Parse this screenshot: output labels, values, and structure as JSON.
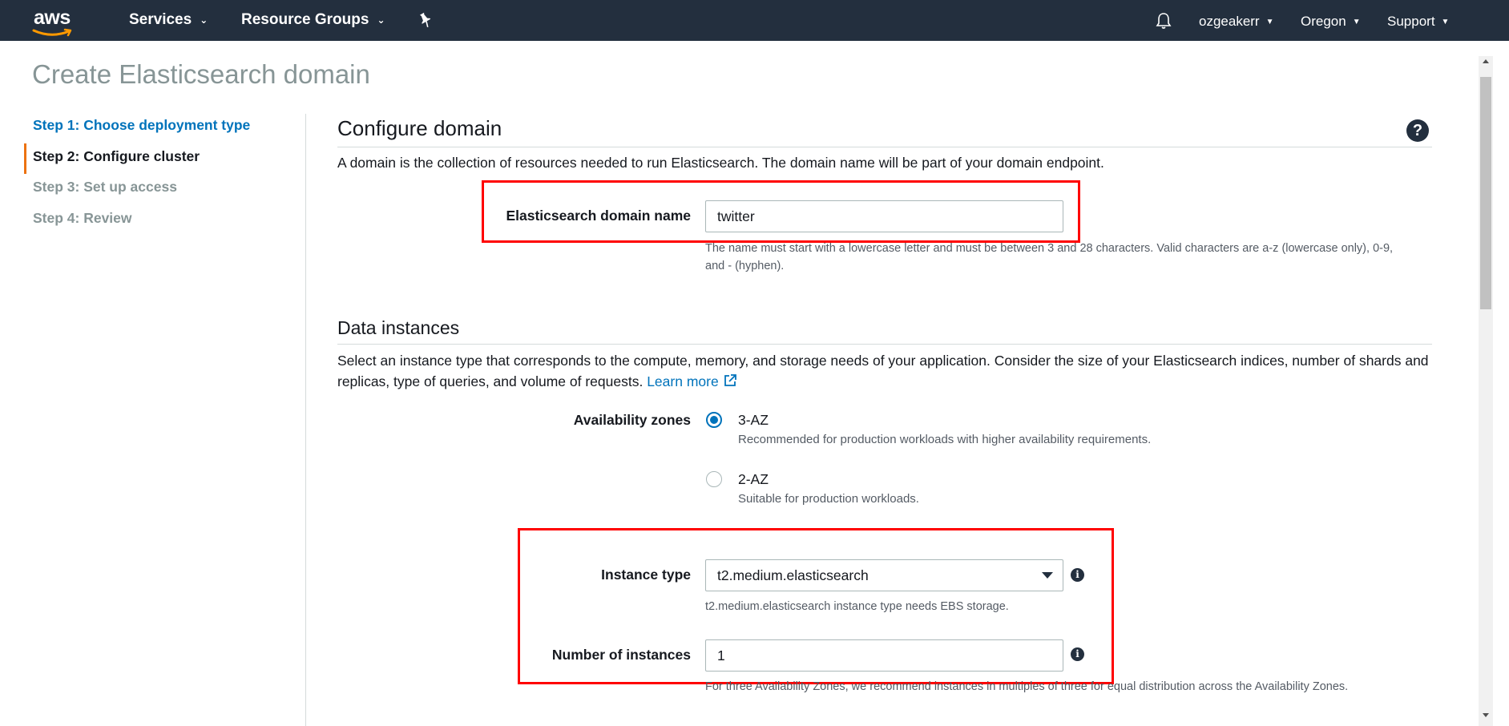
{
  "nav": {
    "logo_text": "aws",
    "services": "Services",
    "resource_groups": "Resource Groups",
    "user": "ozgeakerr",
    "region": "Oregon",
    "support": "Support"
  },
  "page_title": "Create Elasticsearch domain",
  "steps": [
    {
      "label": "Step 1: Choose deployment type",
      "state": "link"
    },
    {
      "label": "Step 2: Configure cluster",
      "state": "active"
    },
    {
      "label": "Step 3: Set up access",
      "state": "disabled"
    },
    {
      "label": "Step 4: Review",
      "state": "disabled"
    }
  ],
  "configure_domain": {
    "title": "Configure domain",
    "description": "A domain is the collection of resources needed to run Elasticsearch. The domain name will be part of your domain endpoint.",
    "domain_name_label": "Elasticsearch domain name",
    "domain_name_value": "twitter",
    "domain_name_hint_1": "The name must start with a lowercase letter and must be between 3 and 28 characters. Valid characters are a-z (lowercase only), 0-9,",
    "domain_name_hint_2": "and - (hyphen)."
  },
  "data_instances": {
    "title": "Data instances",
    "description_1": "Select an instance type that corresponds to the compute, memory, and storage needs of your application. Consider the size of your Elasticsearch indices, number of shards and",
    "description_2": "replicas, type of queries, and volume of requests.",
    "learn_more": "Learn more",
    "availability_label": "Availability zones",
    "az_options": [
      {
        "label": "3-AZ",
        "desc": "Recommended for production workloads with higher availability requirements.",
        "checked": true
      },
      {
        "label": "2-AZ",
        "desc": "Suitable for production workloads.",
        "checked": false
      }
    ],
    "instance_type_label": "Instance type",
    "instance_type_value": "t2.medium.elasticsearch",
    "instance_type_hint": "t2.medium.elasticsearch instance type needs EBS storage.",
    "num_instances_label": "Number of instances",
    "num_instances_value": "1",
    "num_instances_hint": "For three Availability Zones, we recommend instances in multiples of three for equal distribution across the Availability Zones."
  },
  "colors": {
    "nav_bg": "#232f3e",
    "link": "#0073bb",
    "active_step_bar": "#ec7211",
    "highlight": "#ff0000",
    "title_gray": "#879596"
  },
  "icons": {
    "pin": "pin-icon",
    "bell": "bell-icon",
    "help": "help-icon",
    "info": "info-icon",
    "external_link": "external-link-icon"
  }
}
